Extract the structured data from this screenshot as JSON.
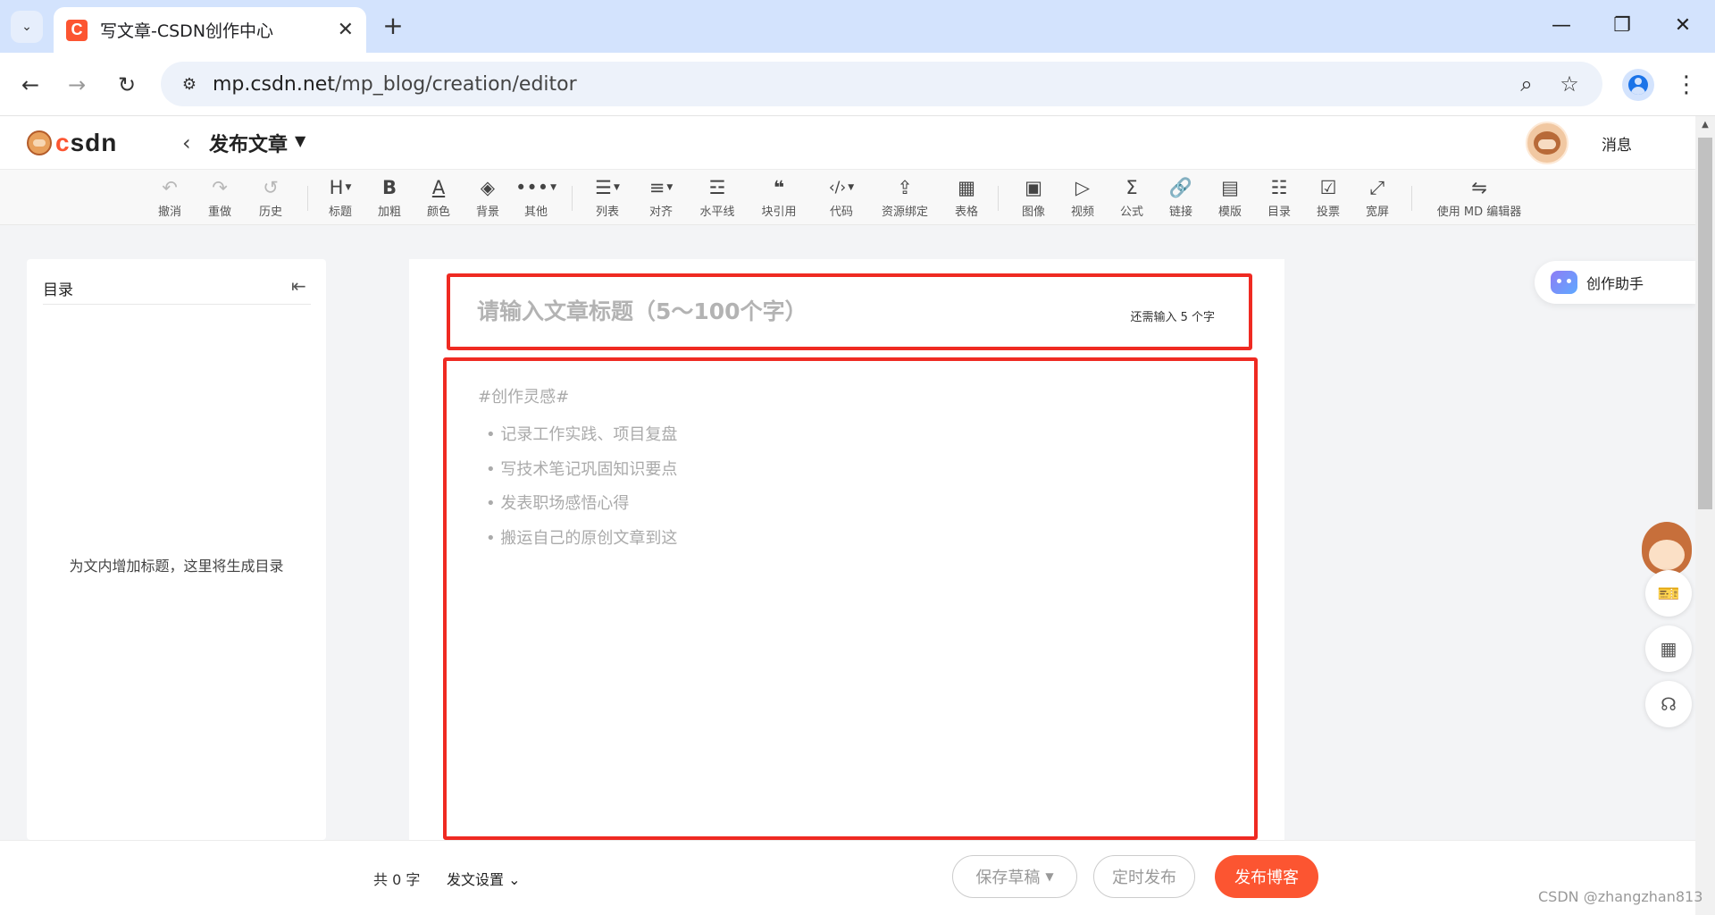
{
  "browser": {
    "tab_title": "写文章-CSDN创作中心",
    "tab_favicon": "C",
    "new_tab": "+",
    "url_domain": "mp.csdn.net",
    "url_path": "/mp_blog/creation/editor"
  },
  "header": {
    "logo_c": "c",
    "logo_rest": "sdn",
    "title": "发布文章",
    "messages": "消息"
  },
  "toolbar": {
    "undo": "撤消",
    "redo": "重做",
    "history": "历史",
    "heading": "标题",
    "bold": "加粗",
    "color": "颜色",
    "background": "背景",
    "more": "其他",
    "list": "列表",
    "align": "对齐",
    "hr": "水平线",
    "quote": "块引用",
    "code": "代码",
    "resource": "资源绑定",
    "table": "表格",
    "image": "图像",
    "video": "视频",
    "formula": "公式",
    "link": "链接",
    "template": "模版",
    "toc": "目录",
    "vote": "投票",
    "widescreen": "宽屏",
    "md_editor": "使用 MD 编辑器"
  },
  "toc": {
    "title": "目录",
    "empty_hint": "为文内增加标题，这里将生成目录"
  },
  "editor": {
    "title_placeholder": "请输入文章标题（5～100个字）",
    "title_counter": "还需输入 5 个字",
    "body_hint": "#创作灵感#",
    "body_items": [
      "记录工作实践、项目复盘",
      "写技术笔记巩固知识要点",
      "发表职场感悟心得",
      "搬运自己的原创文章到这"
    ]
  },
  "assistant": {
    "label": "创作助手"
  },
  "bottom": {
    "word_count": "共 0 字",
    "publish_settings": "发文设置",
    "save_draft": "保存草稿",
    "schedule": "定时发布",
    "publish": "发布博客"
  },
  "watermark": "CSDN @zhangzhan813",
  "colors": {
    "accent": "#fc5531",
    "annotation_red": "#ef2a22",
    "chrome_tabbar": "#d3e3fd"
  }
}
